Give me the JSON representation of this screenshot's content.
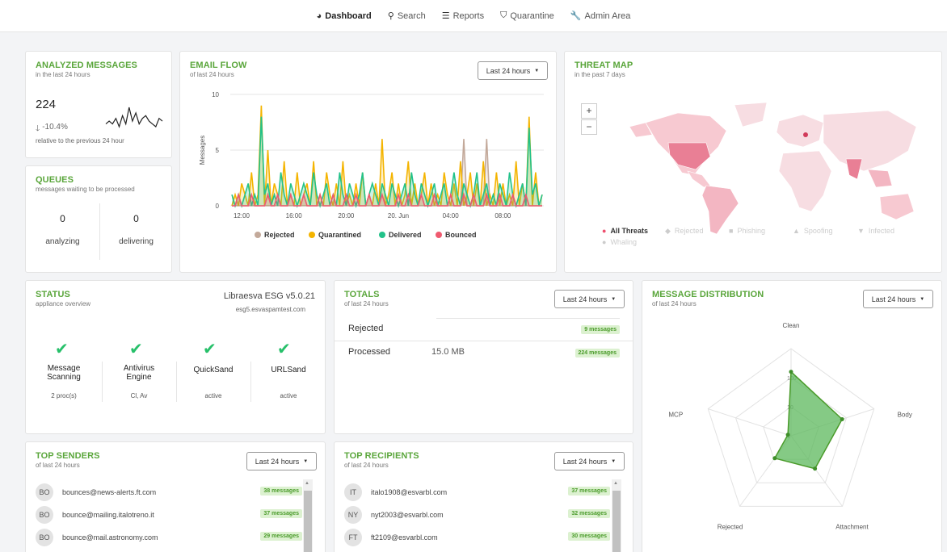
{
  "nav": [
    {
      "label": "Dashboard",
      "icon": "dashboard-icon",
      "active": true
    },
    {
      "label": "Search",
      "icon": "search-icon"
    },
    {
      "label": "Reports",
      "icon": "list-icon"
    },
    {
      "label": "Quarantine",
      "icon": "shield-icon"
    },
    {
      "label": "Admin Area",
      "icon": "wrench-icon"
    }
  ],
  "analyzed": {
    "title": "ANALYZED MESSAGES",
    "subtitle": "in the last 24 hours",
    "count": "224",
    "change": "-10.4%",
    "note": "relative to the previous 24 hour",
    "sparkline": [
      3,
      4,
      3,
      5,
      2,
      6,
      3,
      9,
      4,
      7,
      3,
      5,
      6,
      4,
      3,
      2,
      5,
      4
    ]
  },
  "queues": {
    "title": "QUEUES",
    "subtitle": "messages waiting to be processed",
    "analyzing_value": "0",
    "analyzing_label": "analyzing",
    "delivering_value": "0",
    "delivering_label": "delivering"
  },
  "email_flow": {
    "title": "EMAIL FLOW",
    "subtitle": "of last 24 hours",
    "range": "Last 24 hours"
  },
  "threat_map": {
    "title": "THREAT MAP",
    "subtitle": "in the past 7 days",
    "zoom_in": "+",
    "zoom_out": "−",
    "legend": [
      {
        "label": "All Threats",
        "symbol": "●",
        "color": "#ee4f6e",
        "active": true
      },
      {
        "label": "Rejected",
        "symbol": "◆",
        "color": "#cccccc"
      },
      {
        "label": "Phishing",
        "symbol": "■",
        "color": "#cccccc"
      },
      {
        "label": "Spoofing",
        "symbol": "▲",
        "color": "#cccccc"
      },
      {
        "label": "Infected",
        "symbol": "▼",
        "color": "#cccccc"
      },
      {
        "label": "Whaling",
        "symbol": "●",
        "color": "#cccccc"
      }
    ]
  },
  "status": {
    "title": "STATUS",
    "subtitle": "appliance overview",
    "product": "Libraesva ESG v5.0.21",
    "host": "esg5.esvaspamtest.com",
    "services": [
      {
        "name": "Message Scanning",
        "line1": "Message",
        "line2": "Scanning",
        "detail": "2 proc(s)"
      },
      {
        "name": "Antivirus Engine",
        "line1": "Antivirus",
        "line2": "Engine",
        "detail": "Cl, Av"
      },
      {
        "name": "QuickSand",
        "line1": "QuickSand",
        "line2": "",
        "detail": "active"
      },
      {
        "name": "URLSand",
        "line1": "URLSand",
        "line2": "",
        "detail": "active"
      }
    ]
  },
  "totals": {
    "title": "TOTALS",
    "subtitle": "of last 24 hours",
    "range": "Last 24 hours",
    "rows": [
      {
        "label": "Rejected",
        "size": "",
        "badge": "9 messages"
      },
      {
        "label": "Processed",
        "size": "15.0 MB",
        "badge": "224 messages"
      }
    ]
  },
  "distribution": {
    "title": "MESSAGE DISTRIBUTION",
    "subtitle": "of last 24 hours",
    "range": "Last 24 hours"
  },
  "top_senders": {
    "title": "TOP SENDERS",
    "subtitle": "of last 24 hours",
    "range": "Last 24 hours",
    "rows": [
      {
        "initials": "BO",
        "email": "bounces@news-alerts.ft.com",
        "badge": "38 messages"
      },
      {
        "initials": "BO",
        "email": "bounce@mailing.italotreno.it",
        "badge": "37 messages"
      },
      {
        "initials": "BO",
        "email": "bounce@mail.astronomy.com",
        "badge": "29 messages"
      }
    ]
  },
  "top_recipients": {
    "title": "TOP RECIPIENTS",
    "subtitle": "of last 24 hours",
    "range": "Last 24 hours",
    "rows": [
      {
        "initials": "IT",
        "email": "italo1908@esvarbl.com",
        "badge": "37 messages"
      },
      {
        "initials": "NY",
        "email": "nyt2003@esvarbl.com",
        "badge": "32 messages"
      },
      {
        "initials": "FT",
        "email": "ft2109@esvarbl.com",
        "badge": "30 messages"
      }
    ]
  },
  "chart_data": [
    {
      "type": "line",
      "ylabel": "Messages",
      "ylim": [
        0,
        10
      ],
      "yticks": [
        0,
        5,
        10
      ],
      "xticks": [
        "12:00",
        "16:00",
        "20:00",
        "20. Jun",
        "04:00",
        "08:00"
      ],
      "series": [
        {
          "name": "Rejected",
          "color": "#c3a99a",
          "values": [
            0,
            0,
            0,
            0,
            0,
            0,
            0,
            0,
            0,
            0,
            0,
            0,
            0,
            0,
            0,
            0,
            0,
            0,
            0,
            0,
            0,
            0,
            0,
            0,
            0,
            0,
            0,
            0,
            0,
            0,
            0,
            0,
            0,
            0,
            0,
            0,
            0,
            0,
            0,
            0,
            0,
            0,
            0,
            0,
            0,
            0,
            0,
            0,
            0,
            0,
            0,
            0,
            0,
            0,
            0,
            0,
            0,
            0,
            0,
            0,
            0,
            0,
            0,
            0,
            0,
            0,
            0,
            0,
            0,
            0,
            0,
            6,
            0,
            0,
            0,
            0,
            0,
            0,
            6,
            0,
            0,
            0,
            0,
            0,
            0,
            0,
            0,
            0,
            0,
            0,
            0,
            0,
            0,
            0,
            0,
            0
          ]
        },
        {
          "name": "Quarantined",
          "color": "#f4b400",
          "values": [
            0,
            1,
            0,
            2,
            1,
            0,
            3,
            0,
            1,
            9,
            0,
            5,
            0,
            2,
            1,
            0,
            4,
            0,
            1,
            0,
            3,
            0,
            1,
            2,
            0,
            4,
            0,
            1,
            0,
            3,
            1,
            0,
            2,
            0,
            4,
            0,
            1,
            0,
            2,
            0,
            3,
            0,
            1,
            0,
            2,
            0,
            6,
            0,
            1,
            3,
            0,
            2,
            0,
            1,
            4,
            0,
            2,
            0,
            1,
            3,
            0,
            2,
            0,
            1,
            0,
            3,
            1,
            0,
            2,
            0,
            4,
            0,
            1,
            3,
            0,
            2,
            0,
            4,
            0,
            1,
            0,
            3,
            0,
            2,
            0,
            1,
            0,
            4,
            0,
            2,
            0,
            8,
            0,
            3,
            0,
            1
          ]
        },
        {
          "name": "Delivered",
          "color": "#22c28a",
          "values": [
            1,
            0,
            1,
            0,
            1,
            2,
            0,
            1,
            0,
            8,
            1,
            2,
            0,
            1,
            0,
            3,
            1,
            0,
            2,
            1,
            0,
            1,
            2,
            1,
            0,
            3,
            1,
            0,
            1,
            2,
            0,
            1,
            0,
            3,
            1,
            0,
            2,
            1,
            0,
            1,
            3,
            0,
            1,
            2,
            1,
            0,
            2,
            1,
            0,
            2,
            1,
            0,
            1,
            2,
            0,
            3,
            1,
            0,
            2,
            1,
            0,
            1,
            2,
            0,
            1,
            2,
            0,
            1,
            3,
            1,
            0,
            2,
            1,
            0,
            1,
            3,
            0,
            1,
            2,
            0,
            1,
            0,
            2,
            1,
            0,
            3,
            1,
            0,
            1,
            2,
            0,
            7,
            1,
            2,
            0,
            1
          ]
        },
        {
          "name": "Bounced",
          "color": "#ef5a6f",
          "values": [
            0,
            0,
            1,
            0,
            0,
            0,
            1,
            0,
            0,
            0,
            0,
            1,
            0,
            0,
            1,
            0,
            0,
            0,
            1,
            0,
            0,
            0,
            1,
            0,
            0,
            0,
            0,
            1,
            0,
            0,
            0,
            1,
            0,
            0,
            0,
            1,
            0,
            0,
            1,
            0,
            0,
            0,
            1,
            0,
            0,
            0,
            1,
            0,
            0,
            0,
            0,
            1,
            0,
            0,
            1,
            0,
            0,
            0,
            1,
            0,
            0,
            0,
            1,
            0,
            0,
            0,
            0,
            1,
            0,
            0,
            0,
            1,
            0,
            0,
            1,
            0,
            0,
            0,
            1,
            0,
            0,
            0,
            1,
            0,
            0,
            0,
            1,
            0,
            0,
            0,
            1,
            0,
            0,
            0,
            0,
            0
          ]
        }
      ]
    },
    {
      "type": "radar",
      "axes": [
        "Clean",
        "Body",
        "Attachment",
        "Rejected",
        "MCP"
      ],
      "scale": "log",
      "ticks": [
        "1",
        "10",
        "100"
      ],
      "series": [
        {
          "values": [
            160,
            70,
            25,
            9,
            1.3
          ],
          "color": "#5cb85c"
        }
      ]
    }
  ]
}
